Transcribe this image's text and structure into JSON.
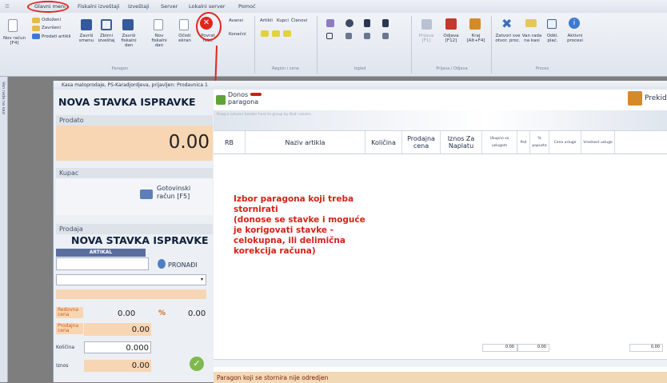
{
  "menubar": {
    "items": [
      "Glavni meni",
      "Fiskalni izveštaji",
      "Izveštaji",
      "Server",
      "Lokalni server",
      "Pomoć"
    ]
  },
  "ribbon": {
    "buttons": [
      "Nov račun [F4]",
      "Odloženi",
      "Završeni",
      "Prodati artikli",
      "Završi smenu",
      "Zbirni izveštaj",
      "Završi fiskalni dan",
      "Nov fiskalni dan",
      "Očisti ekran",
      "Povrat robe",
      "Avansi",
      "Konačni",
      "Artikli",
      "Kupci",
      "Članovi",
      "Prijava [F1]",
      "Odjava [F12]",
      "Kraj [Alt+F4]",
      "Zatvori sve otvor. proc.",
      "Van rada na kasi",
      "Odkl. plać.",
      "Aktivni procesi"
    ],
    "groups": [
      "Paragon",
      "Region i cene",
      "Izgled",
      "Prijava / Odjava",
      "Proces"
    ]
  },
  "sidestrip_label": "Van rada na kasi",
  "window_title": "Kasa maloprodaje, PS-Karadjordjeva, prijavljen: Prodavnica 1",
  "left": {
    "title": "NOVA STAVKA ISPRAVKE",
    "sold_label": "Prodato",
    "sold_value": "0.00",
    "customer_label": "Kupac",
    "cash_receipt": "Gotovinski račun [F5]",
    "sale_label": "Prodaja",
    "sale_title": "NOVA STAVKA ISPRAVKE",
    "article_label": "ARTIKAL",
    "find_label": "PRONAĐI",
    "regular_price_label": "Redovna cena",
    "regular_price": "0.00",
    "percent_sign": "%",
    "percent_value": "0.00",
    "sale_price_label": "Prodajna cena",
    "sale_price": "0.00",
    "qty_label": "Količina",
    "qty": "0.000",
    "amount_label": "Iznos",
    "amount": "0.00"
  },
  "right": {
    "donos_label": "Donos",
    "paragona_label": "paragona",
    "exit_label": "Prekid",
    "group_hint": "Drag a column header here to group by that column",
    "columns": [
      "RB",
      "Naziv artikla",
      "Količina",
      "Prodajna cena",
      "Iznos Za Naplatu",
      "Ukupno sa uslugom",
      "Pež",
      "% popusta",
      "Cena usluge",
      "Vrednost usluge"
    ],
    "footer": [
      "0.00",
      "0.00",
      "0.00"
    ],
    "status": "Paragon koji se stornira nije odredjen"
  },
  "annotation": {
    "line1": "Izbor paragona koji treba",
    "line2": "stornirati",
    "line3": "(donose se stavke i moguće",
    "line4": "je korigovati stavke -",
    "line5": "celokupna, ili delimična",
    "line6": "korekcija računa)"
  },
  "colors": {
    "accent": "#d42118",
    "orange_field": "#f8d6b4",
    "ribbon": "#dfe5ee"
  }
}
